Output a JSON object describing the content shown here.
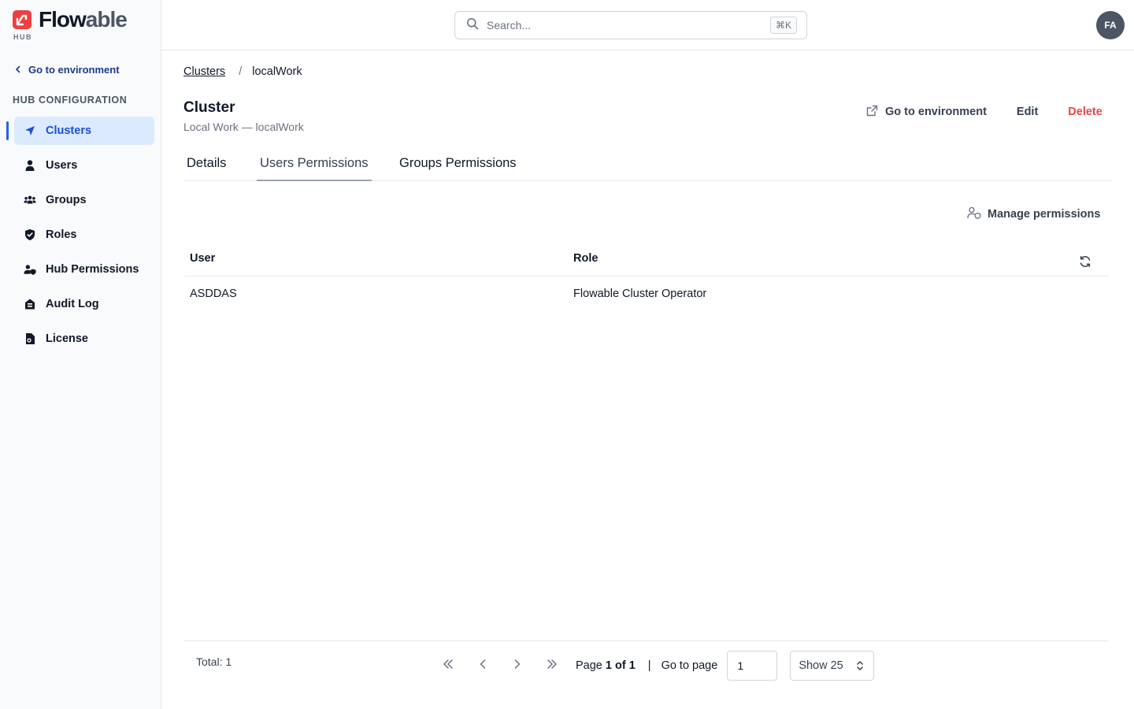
{
  "brand": {
    "name_a": "Flow",
    "name_b": "able",
    "sub": "HUB",
    "accent": "#ef3f3f"
  },
  "sidebar": {
    "back_label": "Go to environment",
    "section_title": "HUB CONFIGURATION",
    "items": [
      {
        "label": "Clusters",
        "icon": "cluster-icon",
        "active": true
      },
      {
        "label": "Users",
        "icon": "user-icon"
      },
      {
        "label": "Groups",
        "icon": "groups-icon"
      },
      {
        "label": "Roles",
        "icon": "shield-icon"
      },
      {
        "label": "Hub Permissions",
        "icon": "user-shield-icon"
      },
      {
        "label": "Audit Log",
        "icon": "audit-icon"
      },
      {
        "label": "License",
        "icon": "license-icon"
      }
    ]
  },
  "topbar": {
    "search_placeholder": "Search...",
    "search_shortcut": "⌘K",
    "avatar_initials": "FA"
  },
  "breadcrumb": {
    "parent": "Clusters",
    "separator": "/",
    "current": "localWork"
  },
  "page": {
    "title": "Cluster",
    "subtitle": "Local Work — localWork"
  },
  "actions": {
    "goto": "Go to environment",
    "edit": "Edit",
    "delete": "Delete"
  },
  "tabs": [
    {
      "label": "Details"
    },
    {
      "label": "Users Permissions",
      "active": true
    },
    {
      "label": "Groups Permissions"
    }
  ],
  "manage_label": "Manage permissions",
  "table": {
    "columns": [
      "User",
      "Role"
    ],
    "rows": [
      {
        "user": "ASDDAS",
        "role": "Flowable Cluster Operator"
      }
    ]
  },
  "pagination": {
    "total_label": "Total: 1",
    "page_prefix": "Page ",
    "page_value": "1 of 1",
    "pipe": "|",
    "goto_label": "Go to page",
    "goto_value": "1",
    "show_label": "Show 25"
  }
}
